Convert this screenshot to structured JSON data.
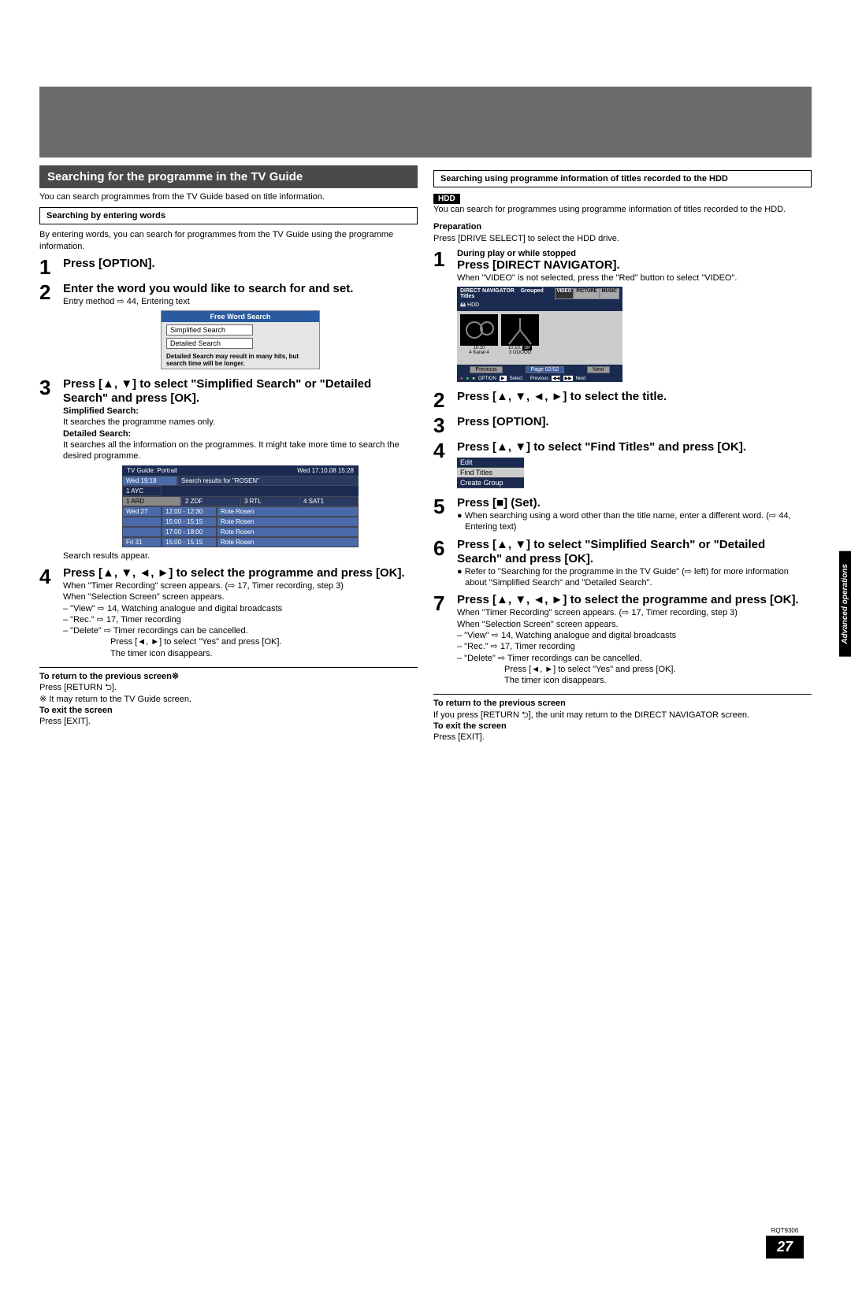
{
  "leftCol": {
    "sectionHeader": "Searching for the programme in the TV Guide",
    "intro": "You can search programmes from the TV Guide based on title information.",
    "subBox1": "Searching by entering words",
    "subBox1Text": "By entering words, you can search for programmes from the TV Guide using the programme information.",
    "step1": "Press [OPTION].",
    "step2Title": "Enter the word you would like to search for and set.",
    "step2Sub": "Entry method ⇨ 44, Entering text",
    "graphic1": {
      "header": "Free Word Search",
      "btn1": "Simplified Search",
      "btn2": "Detailed Search",
      "note": "Detailed Search may result in many hits, but search time will be longer."
    },
    "step3Title": "Press [▲, ▼] to select \"Simplified Search\" or \"Detailed Search\" and press [OK].",
    "step3Simp": "Simplified Search:",
    "step3SimpText": "It searches the programme names only.",
    "step3Det": "Detailed Search:",
    "step3DetText": "It searches all the information on the programmes. It might take more time to search the desired programme.",
    "graphic2": {
      "headerLeft": "TV Guide: Portrait",
      "headerRight": "Wed 17.10.08    15:28",
      "row1Left": "Wed 19:18",
      "row1Right": "Search results for \"ROSEN\"",
      "tab0": "1 AYC",
      "tab1": "1 ARD",
      "tab2": "2 ZDF",
      "tab3": "3 RTL",
      "tab4": "4 SAT1",
      "r1a": "Wed 27",
      "r1b": "12:00 - 12:30",
      "r1c": "Rote Rosen",
      "r2b": "15:00 - 15:15",
      "r2c": "Rote Rosen",
      "r3b": "17:00 - 18:00",
      "r3c": "Rote Rosen",
      "r4a": "Fri 31",
      "r4b": "15:00 - 15:15",
      "r4c": "Rote Rosen"
    },
    "searchResults": "Search results appear.",
    "step4Title": "Press [▲, ▼, ◄, ►] to select the programme and press [OK].",
    "step4L1": "When \"Timer Recording\" screen appears. (⇨ 17, Timer recording, step 3)",
    "step4L2": "When \"Selection Screen\" screen appears.",
    "step4View": "– \"View\" ⇨ 14, Watching analogue and digital broadcasts",
    "step4Rec": "– \"Rec.\" ⇨ 17, Timer recording",
    "step4Del": "– \"Delete\" ⇨ Timer recordings can be cancelled.",
    "step4DelSub1": "Press [◄, ►] to select \"Yes\" and press [OK].",
    "step4DelSub2": "The timer icon disappears.",
    "returnTitle": "To return to the previous screen※",
    "returnBody": "Press [RETURN ⮌].",
    "returnNote": "※  It may return to the TV Guide screen.",
    "exitTitle": "To exit the screen",
    "exitBody": "Press [EXIT]."
  },
  "rightCol": {
    "subBox": "Searching using programme information of titles recorded to the HDD",
    "hddBadge": "HDD",
    "intro": "You can search for programmes using programme information of titles recorded to the HDD.",
    "prepLabel": "Preparation",
    "prepText": "Press [DRIVE SELECT] to select the HDD drive.",
    "step1Pre": "During play or while stopped",
    "step1Title": "Press [DIRECT NAVIGATOR].",
    "step1Sub": "When \"VIDEO\" is not selected, press the \"Red\" button to select \"VIDEO\".",
    "navGraphic": {
      "title": "DIRECT NAVIGATOR",
      "subtitle": "Grouped Titles",
      "hdd": "🖴 HDD",
      "tabs": [
        "VIDEO",
        "PICTURE",
        "MUSIC"
      ],
      "thumb1L1": "10.10",
      "thumb1L2": "4 Kanal 4",
      "thumb2L1": "10.10.",
      "thumb2L2": "3 OOOOO",
      "thumb2top": "SP",
      "prev": "Previous",
      "page": "Page 02/02",
      "next": "Next",
      "ctrlOption": "OPTION",
      "ctrlSelect": "Select",
      "ctrlPrev": "Previous",
      "ctrlNext": "Next"
    },
    "step2": "Press [▲, ▼, ◄, ►] to select the title.",
    "step3": "Press [OPTION].",
    "step4": "Press [▲, ▼] to select \"Find Titles\" and press [OK].",
    "editMenu": {
      "item1": "Edit",
      "item2": "Find Titles",
      "item3": "Create Group"
    },
    "step5Title": "Press [■] (Set).",
    "step5Note": "● When searching using a word other than the title name, enter a different word. (⇨ 44, Entering text)",
    "step6Title": "Press [▲, ▼] to select \"Simplified Search\" or \"Detailed Search\" and press [OK].",
    "step6Note": "● Refer to \"Searching for the programme in the TV Guide\" (⇨ left) for more information about \"Simplified Search\" and \"Detailed Search\".",
    "step7Title": "Press [▲, ▼, ◄, ►] to select the programme and press [OK].",
    "step7L1": "When \"Timer Recording\" screen appears. (⇨ 17, Timer recording, step 3)",
    "step7L2": "When \"Selection Screen\" screen appears.",
    "step7View": "– \"View\" ⇨ 14, Watching analogue and digital broadcasts",
    "step7Rec": "– \"Rec.\" ⇨ 17, Timer recording",
    "step7Del": "– \"Delete\" ⇨ Timer recordings can be cancelled.",
    "step7DelSub1": "Press [◄, ►] to select \"Yes\" and press [OK].",
    "step7DelSub2": "The timer icon disappears.",
    "returnTitle": "To return to the previous screen",
    "returnBody": "If you press [RETURN ⮌], the unit may return to the DIRECT NAVIGATOR screen.",
    "exitTitle": "To exit the screen",
    "exitBody": "Press [EXIT]."
  },
  "sideTab": "Advanced operations",
  "rqt": "RQT9306",
  "pageNum": "27"
}
